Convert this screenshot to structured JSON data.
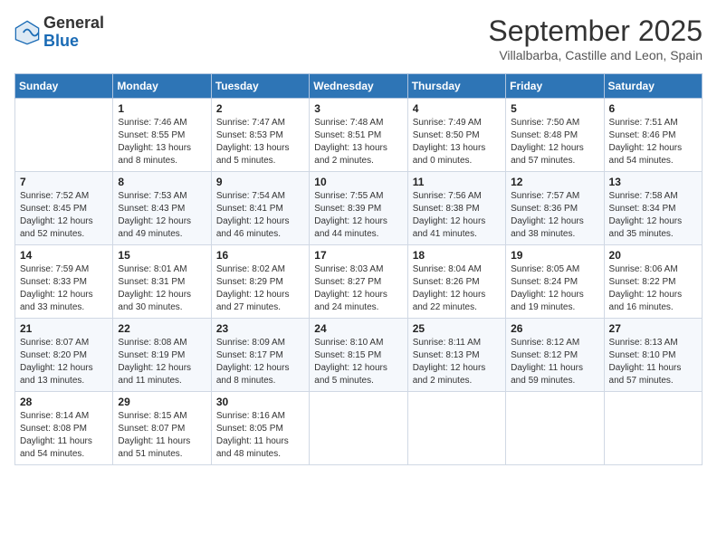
{
  "logo": {
    "general": "General",
    "blue": "Blue"
  },
  "title": "September 2025",
  "subtitle": "Villalbarba, Castille and Leon, Spain",
  "headers": [
    "Sunday",
    "Monday",
    "Tuesday",
    "Wednesday",
    "Thursday",
    "Friday",
    "Saturday"
  ],
  "weeks": [
    [
      {
        "day": "",
        "info": ""
      },
      {
        "day": "1",
        "info": "Sunrise: 7:46 AM\nSunset: 8:55 PM\nDaylight: 13 hours\nand 8 minutes."
      },
      {
        "day": "2",
        "info": "Sunrise: 7:47 AM\nSunset: 8:53 PM\nDaylight: 13 hours\nand 5 minutes."
      },
      {
        "day": "3",
        "info": "Sunrise: 7:48 AM\nSunset: 8:51 PM\nDaylight: 13 hours\nand 2 minutes."
      },
      {
        "day": "4",
        "info": "Sunrise: 7:49 AM\nSunset: 8:50 PM\nDaylight: 13 hours\nand 0 minutes."
      },
      {
        "day": "5",
        "info": "Sunrise: 7:50 AM\nSunset: 8:48 PM\nDaylight: 12 hours\nand 57 minutes."
      },
      {
        "day": "6",
        "info": "Sunrise: 7:51 AM\nSunset: 8:46 PM\nDaylight: 12 hours\nand 54 minutes."
      }
    ],
    [
      {
        "day": "7",
        "info": "Sunrise: 7:52 AM\nSunset: 8:45 PM\nDaylight: 12 hours\nand 52 minutes."
      },
      {
        "day": "8",
        "info": "Sunrise: 7:53 AM\nSunset: 8:43 PM\nDaylight: 12 hours\nand 49 minutes."
      },
      {
        "day": "9",
        "info": "Sunrise: 7:54 AM\nSunset: 8:41 PM\nDaylight: 12 hours\nand 46 minutes."
      },
      {
        "day": "10",
        "info": "Sunrise: 7:55 AM\nSunset: 8:39 PM\nDaylight: 12 hours\nand 44 minutes."
      },
      {
        "day": "11",
        "info": "Sunrise: 7:56 AM\nSunset: 8:38 PM\nDaylight: 12 hours\nand 41 minutes."
      },
      {
        "day": "12",
        "info": "Sunrise: 7:57 AM\nSunset: 8:36 PM\nDaylight: 12 hours\nand 38 minutes."
      },
      {
        "day": "13",
        "info": "Sunrise: 7:58 AM\nSunset: 8:34 PM\nDaylight: 12 hours\nand 35 minutes."
      }
    ],
    [
      {
        "day": "14",
        "info": "Sunrise: 7:59 AM\nSunset: 8:33 PM\nDaylight: 12 hours\nand 33 minutes."
      },
      {
        "day": "15",
        "info": "Sunrise: 8:01 AM\nSunset: 8:31 PM\nDaylight: 12 hours\nand 30 minutes."
      },
      {
        "day": "16",
        "info": "Sunrise: 8:02 AM\nSunset: 8:29 PM\nDaylight: 12 hours\nand 27 minutes."
      },
      {
        "day": "17",
        "info": "Sunrise: 8:03 AM\nSunset: 8:27 PM\nDaylight: 12 hours\nand 24 minutes."
      },
      {
        "day": "18",
        "info": "Sunrise: 8:04 AM\nSunset: 8:26 PM\nDaylight: 12 hours\nand 22 minutes."
      },
      {
        "day": "19",
        "info": "Sunrise: 8:05 AM\nSunset: 8:24 PM\nDaylight: 12 hours\nand 19 minutes."
      },
      {
        "day": "20",
        "info": "Sunrise: 8:06 AM\nSunset: 8:22 PM\nDaylight: 12 hours\nand 16 minutes."
      }
    ],
    [
      {
        "day": "21",
        "info": "Sunrise: 8:07 AM\nSunset: 8:20 PM\nDaylight: 12 hours\nand 13 minutes."
      },
      {
        "day": "22",
        "info": "Sunrise: 8:08 AM\nSunset: 8:19 PM\nDaylight: 12 hours\nand 11 minutes."
      },
      {
        "day": "23",
        "info": "Sunrise: 8:09 AM\nSunset: 8:17 PM\nDaylight: 12 hours\nand 8 minutes."
      },
      {
        "day": "24",
        "info": "Sunrise: 8:10 AM\nSunset: 8:15 PM\nDaylight: 12 hours\nand 5 minutes."
      },
      {
        "day": "25",
        "info": "Sunrise: 8:11 AM\nSunset: 8:13 PM\nDaylight: 12 hours\nand 2 minutes."
      },
      {
        "day": "26",
        "info": "Sunrise: 8:12 AM\nSunset: 8:12 PM\nDaylight: 11 hours\nand 59 minutes."
      },
      {
        "day": "27",
        "info": "Sunrise: 8:13 AM\nSunset: 8:10 PM\nDaylight: 11 hours\nand 57 minutes."
      }
    ],
    [
      {
        "day": "28",
        "info": "Sunrise: 8:14 AM\nSunset: 8:08 PM\nDaylight: 11 hours\nand 54 minutes."
      },
      {
        "day": "29",
        "info": "Sunrise: 8:15 AM\nSunset: 8:07 PM\nDaylight: 11 hours\nand 51 minutes."
      },
      {
        "day": "30",
        "info": "Sunrise: 8:16 AM\nSunset: 8:05 PM\nDaylight: 11 hours\nand 48 minutes."
      },
      {
        "day": "",
        "info": ""
      },
      {
        "day": "",
        "info": ""
      },
      {
        "day": "",
        "info": ""
      },
      {
        "day": "",
        "info": ""
      }
    ]
  ]
}
